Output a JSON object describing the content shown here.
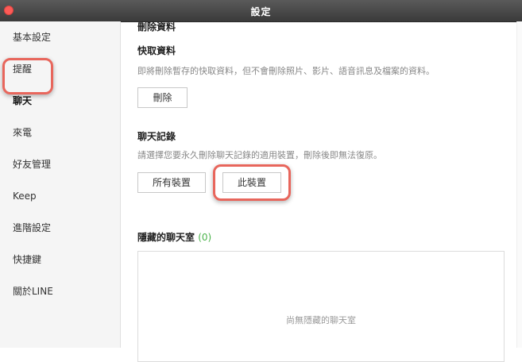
{
  "window": {
    "title": "設定"
  },
  "sidebar": {
    "items": [
      {
        "label": "基本設定",
        "active": false
      },
      {
        "label": "提醒",
        "active": false
      },
      {
        "label": "聊天",
        "active": true
      },
      {
        "label": "來電",
        "active": false
      },
      {
        "label": "好友管理",
        "active": false
      },
      {
        "label": "Keep",
        "active": false
      },
      {
        "label": "進階設定",
        "active": false
      },
      {
        "label": "快捷鍵",
        "active": false
      },
      {
        "label": "關於LINE",
        "active": false
      }
    ]
  },
  "main": {
    "section_title": "刪除資料",
    "cache": {
      "title": "快取資料",
      "description": "即將刪除暫存的快取資料，但不會刪除照片、影片、語音訊息及檔案的資料。",
      "delete_button": "刪除"
    },
    "chat_history": {
      "title": "聊天記錄",
      "description": "請選擇您要永久刪除聊天記錄的適用裝置，刪除後即無法復原。",
      "all_devices_button": "所有裝置",
      "this_device_button": "此裝置"
    },
    "hidden_chats": {
      "title": "隱藏的聊天室",
      "count": "(0)",
      "empty_text": "尚無隱藏的聊天室"
    }
  },
  "colors": {
    "highlight": "#e8665c",
    "count_green": "#4bb34b",
    "titlebar": "#4a4a4a"
  }
}
